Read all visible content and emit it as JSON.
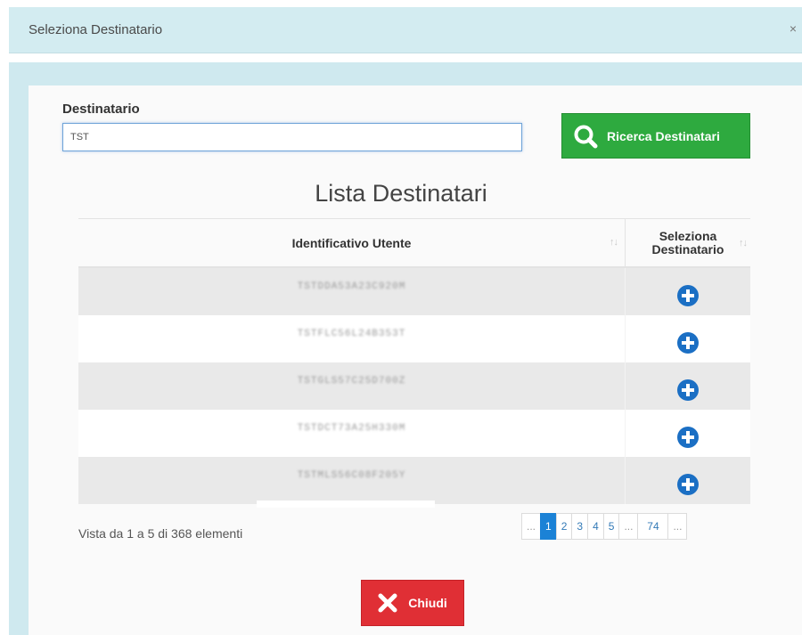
{
  "dialog": {
    "title": "Seleziona Destinatario",
    "close_symbol": "×"
  },
  "search": {
    "label": "Destinatario",
    "value": "TST",
    "button_label": "Ricerca Destinatari",
    "button_icon": "search-icon"
  },
  "list": {
    "title": "Lista Destinatari",
    "columns": [
      "Identificativo Utente",
      "Seleziona Destinatario"
    ],
    "sort_glyph": "↑↓",
    "rows": [
      {
        "id": "TSTDDA53A23C920M"
      },
      {
        "id": "TSTFLC56L24B353T"
      },
      {
        "id": "TSTGLS57C25D700Z"
      },
      {
        "id": "TSTDCT73A25H330M"
      },
      {
        "id": "TSTMLS56C08F205Y"
      }
    ],
    "row_action_icon": "plus-circle-icon"
  },
  "footer": {
    "info": "Vista da 1 a 5 di 368 elementi",
    "pagination": [
      "...",
      "1",
      "2",
      "3",
      "4",
      "5",
      "...",
      "74",
      "..."
    ],
    "active_page": "1",
    "close_label": "Chiudi",
    "close_icon": "x-icon"
  },
  "colors": {
    "header_bg": "#d3ecf1",
    "search_button": "#2eaa3f",
    "close_button": "#e02f35",
    "active_page": "#1b82d6",
    "row_icon": "#1b6fc4"
  }
}
